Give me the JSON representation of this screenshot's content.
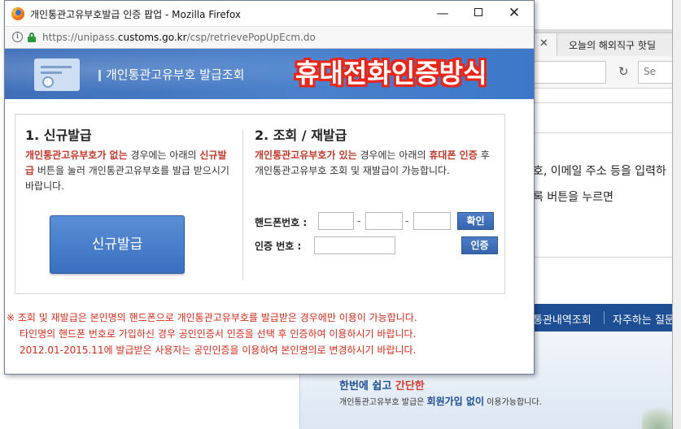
{
  "background": {
    "tab_label": "오늘의 해외직구 핫딜 ",
    "search_placeholder": "Se",
    "text_line1": "호, 이메일 주소 등을 입력하",
    "text_line2": "록 버튼을 누르면",
    "menu_item1": "통관내역조회",
    "menu_item2": "자주하는 질문",
    "hero_line1_a": "한번",
    "hero_line1_b": "에 쉽고 ",
    "hero_line1_c": "간단한",
    "hero_line2_a": "개인통관고유부호 발급은 ",
    "hero_line2_b": "회원가입 없이",
    "hero_line2_c": " 이용가능합니다."
  },
  "window": {
    "title": "개인통관고유부호발급 인증 팝업 - Mozilla Firefox",
    "minimize": "—",
    "close": "✕"
  },
  "address_bar": {
    "url_prefix": "https://unipass.",
    "url_domain": "customs.go.kr",
    "url_path": "/csp/retrievePopUpEcm.do"
  },
  "header": {
    "title": "개인통관고유부호 발급조회",
    "overlay_text": "휴대전화인증방식"
  },
  "section_new": {
    "title": "1. 신규발급",
    "desc_red1": "개인통관고유부호가 없는",
    "desc_text1": " 경우에는 아래의 ",
    "desc_red2": "신규발급",
    "desc_text2": " 버튼을 눌러 개인통관고유부호를 발급 받으시기 바랍니다.",
    "button_label": "신규발급"
  },
  "section_reissue": {
    "title": "2. 조회 / 재발급",
    "desc_red1": "개인통관고유부호가 있는",
    "desc_text1": " 경우에는 아래의 ",
    "desc_red2": "휴대폰 인증",
    "desc_text2": " 후 개인통관고유부호 조회 및 재발급이 가능합니다.",
    "phone_label": "핸드폰번호 :",
    "dash": "-",
    "confirm_button": "확인",
    "code_label": "인증  번호 :",
    "auth_button": "인증"
  },
  "notice": {
    "line1": "※ 조회 및 재발급은 본인명의 핸드폰으로 개인통관고유부호를 발급받은 경우에만 이용이 가능합니다.",
    "line2": "타인명의 핸드폰 번호로 가입하신 경우 공인인증서 인증을 선택 후 인증하여 이용하시기 바랍니다.",
    "line3": "2012.01-2015.11에 발급받은 사용자는 공인인증을 이용하여 본인명의로 변경하시기 바랍니다."
  },
  "colors": {
    "header_blue": "#4b81cc",
    "button_blue": "#3a6fbf",
    "notice_red": "#d22b1c",
    "overlay_red": "#e8261a"
  }
}
